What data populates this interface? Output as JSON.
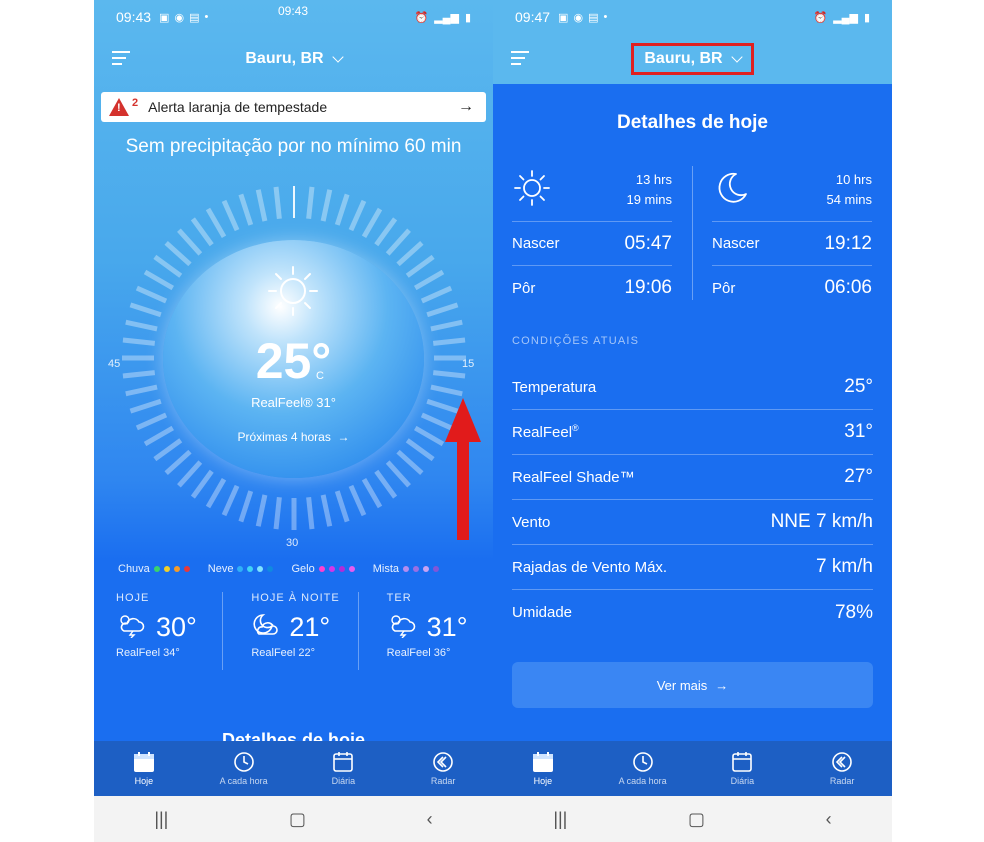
{
  "left": {
    "status_time": "09:43",
    "location": "Bauru, BR",
    "alert": {
      "count": "2",
      "text": "Alerta laranja de tempestade"
    },
    "precip_text": "Sem precipitação por no mínimo 60 min",
    "dial": {
      "top": "09:43",
      "left": "45",
      "right": "15",
      "bottom": "30"
    },
    "temperature": "25°",
    "unit": "C",
    "realfeel": "RealFeel® 31°",
    "next_hours": "Próximas 4 horas",
    "legend": [
      {
        "label": "Chuva",
        "colors": [
          "#3bd36b",
          "#f2d02b",
          "#f59b2a",
          "#e63a3a"
        ]
      },
      {
        "label": "Neve",
        "colors": [
          "#2fb0f7",
          "#40d3f5",
          "#7fe3ff",
          "#0f8ae0"
        ]
      },
      {
        "label": "Gelo",
        "colors": [
          "#ff3fd0",
          "#d236e8",
          "#b02cd8",
          "#e65cf0"
        ]
      },
      {
        "label": "Mista",
        "colors": [
          "#b58cf0",
          "#9a6fe4",
          "#c9a2f5",
          "#8256d8"
        ]
      }
    ],
    "forecast": [
      {
        "label": "HOJE",
        "temp": "30°",
        "realfeel": "RealFeel 34°",
        "icon": "thunderstorm-icon"
      },
      {
        "label": "HOJE À NOITE",
        "temp": "21°",
        "realfeel": "RealFeel 22°",
        "icon": "moon-cloud-icon"
      },
      {
        "label": "TER",
        "temp": "31°",
        "realfeel": "RealFeel 36°",
        "icon": "thunderstorm-icon"
      }
    ],
    "peek_title": "Detalhes de hoje"
  },
  "right": {
    "status_time": "09:47",
    "location": "Bauru, BR",
    "details_title": "Detalhes de hoje",
    "sun": {
      "duration_1": "13 hrs",
      "duration_2": "19 mins",
      "rise_label": "Nascer",
      "rise": "05:47",
      "set_label": "Pôr",
      "set": "19:06"
    },
    "moon": {
      "duration_1": "10 hrs",
      "duration_2": "54 mins",
      "rise_label": "Nascer",
      "rise": "19:12",
      "set_label": "Pôr",
      "set": "06:06"
    },
    "conditions_title": "CONDIÇÕES ATUAIS",
    "conditions": [
      {
        "label": "Temperatura",
        "value": "25°"
      },
      {
        "label": "RealFeel",
        "sup": "®",
        "value": "31°"
      },
      {
        "label": "RealFeel Shade™",
        "value": "27°"
      },
      {
        "label": "Vento",
        "value": "NNE 7 km/h"
      },
      {
        "label": "Rajadas de Vento Máx.",
        "value": "7 km/h"
      },
      {
        "label": "Umidade",
        "value": "78%"
      }
    ],
    "more_button": "Ver mais"
  },
  "nav": [
    {
      "label": "Hoje",
      "icon": "calendar-today-icon"
    },
    {
      "label": "A cada hora",
      "icon": "clock-icon"
    },
    {
      "label": "Diária",
      "icon": "calendar-icon"
    },
    {
      "label": "Radar",
      "icon": "radar-icon"
    }
  ],
  "colors": {
    "accent": "#1a6ef0",
    "navbar": "#1d5fc4",
    "alert_red": "#d4322d",
    "highlight": "#e02020"
  }
}
